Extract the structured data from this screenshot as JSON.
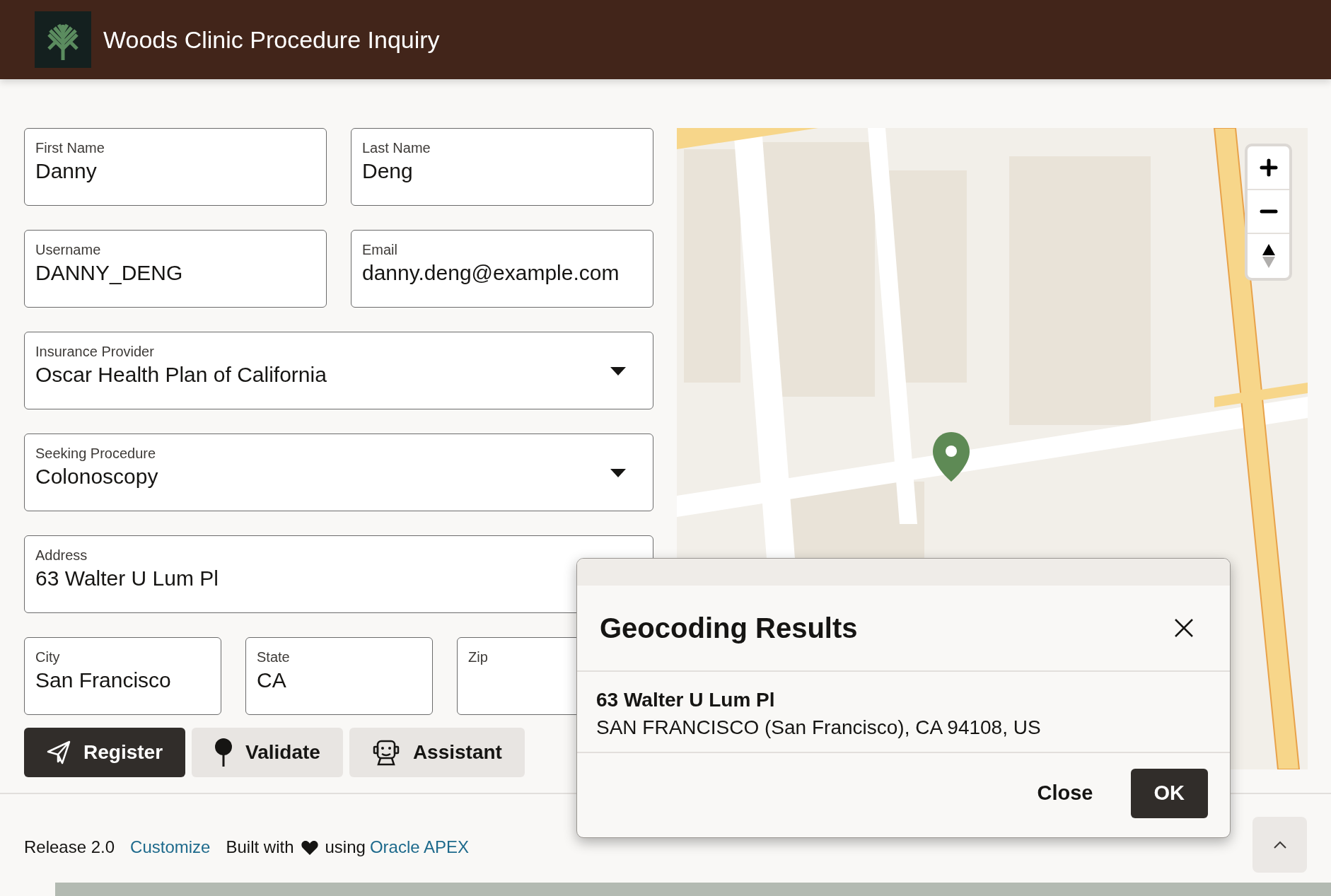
{
  "header": {
    "title": "Woods Clinic Procedure Inquiry"
  },
  "form": {
    "fields": [
      {
        "kind": "text",
        "label": "First Name",
        "value": "Danny"
      },
      {
        "kind": "text",
        "label": "Last Name",
        "value": "Deng"
      },
      {
        "kind": "text",
        "label": "Username",
        "value": "DANNY_DENG"
      },
      {
        "kind": "text",
        "label": "Email",
        "value": "danny.deng@example.com"
      },
      {
        "kind": "select",
        "label": "Insurance Provider",
        "value": "Oscar Health Plan of California"
      },
      {
        "kind": "select",
        "label": "Seeking Procedure",
        "value": "Colonoscopy"
      },
      {
        "kind": "text",
        "label": "Address",
        "value": "63 Walter U Lum Pl"
      },
      {
        "kind": "text",
        "label": "City",
        "value": "San Francisco"
      },
      {
        "kind": "text",
        "label": "State",
        "value": "CA"
      },
      {
        "kind": "text",
        "label": "Zip"
      }
    ],
    "buttons": [
      {
        "label": "Register",
        "primary": true
      },
      {
        "label": "Validate",
        "primary": false
      },
      {
        "label": "Assistant",
        "primary": false
      }
    ]
  },
  "dialog": {
    "title": "Geocoding Results",
    "result": {
      "line1": "63 Walter U Lum Pl",
      "line2": "SAN FRANCISCO (San Francisco), CA 94108, US"
    },
    "buttons": [
      {
        "label": "Close",
        "primary": false
      },
      {
        "label": "OK",
        "primary": true
      }
    ]
  },
  "footer": {
    "release": "Release 2.0",
    "customize_link": "Customize",
    "built_with": "Built with",
    "using": "using",
    "apex_link": "Oracle APEX"
  }
}
